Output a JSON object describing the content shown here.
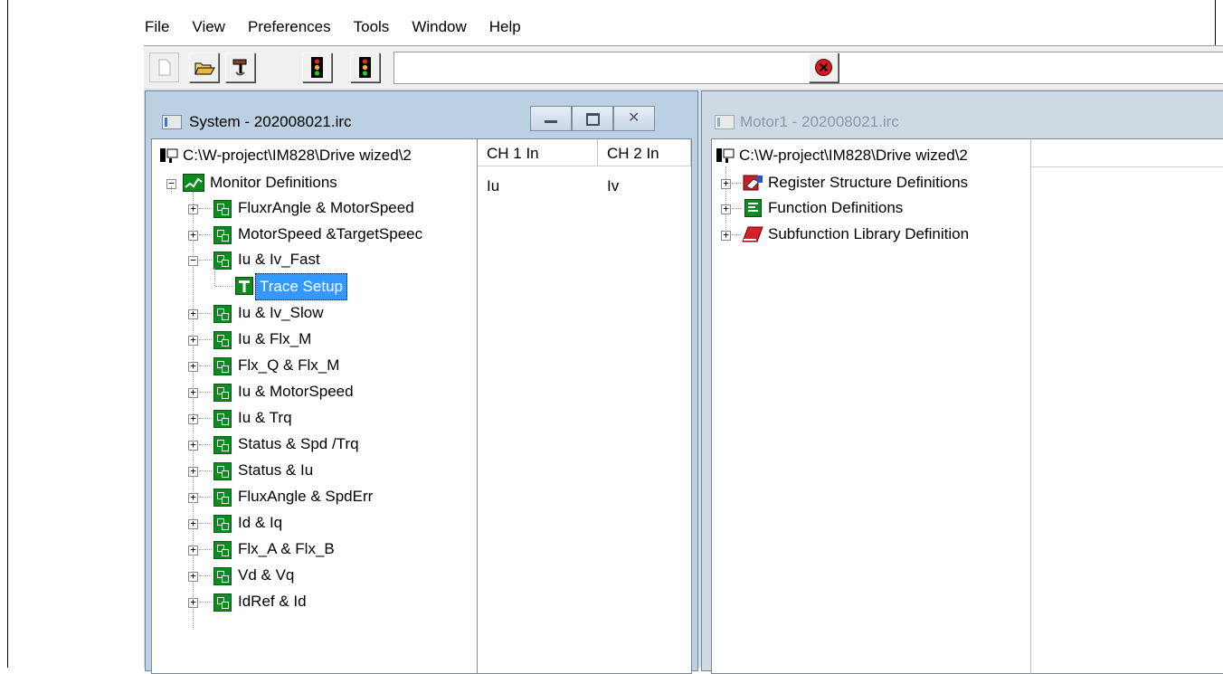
{
  "menu": [
    "File",
    "View",
    "Preferences",
    "Tools",
    "Window",
    "Help"
  ],
  "toolbar": {
    "icons": [
      "new-file-icon",
      "open-folder-icon",
      "build-hammer-icon",
      "traffic-light-icon",
      "traffic-light-icon",
      "stop-icon"
    ]
  },
  "system_window": {
    "title": "System  - 202008021.irc",
    "path": "C:\\W-project\\IM828\\Drive wized\\2",
    "root": "Monitor Definitions",
    "items": [
      "FluxrAngle & MotorSpeed",
      "MotorSpeed &TargetSpeec",
      "Iu & Iv_Fast",
      "Trace Setup",
      "Iu & Iv_Slow",
      "Iu & Flx_M",
      "Flx_Q & Flx_M",
      "Iu & MotorSpeed",
      "Iu & Trq",
      "Status & Spd /Trq",
      "Status & Iu",
      "FluxAngle & SpdErr",
      "Id & Iq",
      "Flx_A & Flx_B",
      "Vd & Vq",
      "IdRef & Id"
    ],
    "columns": [
      "CH 1 In",
      "CH 2 In"
    ],
    "values": [
      "Iu",
      "Iv"
    ]
  },
  "motor_window": {
    "title": "Motor1  - 202008021.irc",
    "path": "C:\\W-project\\IM828\\Drive wized\\2",
    "items": [
      "Register Structure Definitions",
      "Function Definitions",
      "Subfunction Library Definition"
    ]
  },
  "colors": {
    "selection": "#3399ff",
    "tree_icon": "#0f8a1f",
    "titlebar": "#bcd0e4"
  }
}
